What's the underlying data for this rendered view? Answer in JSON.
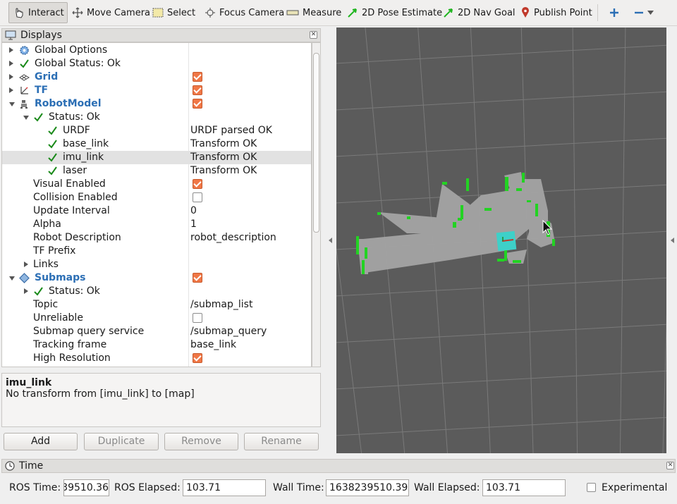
{
  "toolbar": {
    "interact": "Interact",
    "move_camera": "Move Camera",
    "select": "Select",
    "focus_camera": "Focus Camera",
    "measure": "Measure",
    "pose_estimate": "2D Pose Estimate",
    "nav_goal": "2D Nav Goal",
    "publish_point": "Publish Point"
  },
  "displays": {
    "title": "Displays",
    "rows": [
      {
        "name": "Global Options",
        "value": ""
      },
      {
        "name": "Global Status: Ok",
        "value": ""
      },
      {
        "name": "Grid",
        "value": "",
        "checked": true
      },
      {
        "name": "TF",
        "value": "",
        "checked": true
      },
      {
        "name": "RobotModel",
        "value": "",
        "checked": true
      },
      {
        "name": "Status: Ok",
        "value": ""
      },
      {
        "name": "URDF",
        "value": "URDF parsed OK"
      },
      {
        "name": "base_link",
        "value": "Transform OK"
      },
      {
        "name": "imu_link",
        "value": "Transform OK"
      },
      {
        "name": "laser",
        "value": "Transform OK"
      },
      {
        "name": "Visual Enabled",
        "value": "",
        "checked": true
      },
      {
        "name": "Collision Enabled",
        "value": "",
        "checked": false
      },
      {
        "name": "Update Interval",
        "value": "0"
      },
      {
        "name": "Alpha",
        "value": "1"
      },
      {
        "name": "Robot Description",
        "value": "robot_description"
      },
      {
        "name": "TF Prefix",
        "value": ""
      },
      {
        "name": "Links",
        "value": ""
      },
      {
        "name": "Submaps",
        "value": "",
        "checked": true
      },
      {
        "name": "Status: Ok",
        "value": ""
      },
      {
        "name": "Topic",
        "value": "/submap_list"
      },
      {
        "name": "Unreliable",
        "value": "",
        "checked": false
      },
      {
        "name": "Submap query service",
        "value": "/submap_query"
      },
      {
        "name": "Tracking frame",
        "value": "base_link"
      },
      {
        "name": "High Resolution",
        "value": "",
        "checked": true
      }
    ]
  },
  "description": {
    "title": "imu_link",
    "body": "No transform from [imu_link] to [map]"
  },
  "buttons": {
    "add": "Add",
    "duplicate": "Duplicate",
    "remove": "Remove",
    "rename": "Rename"
  },
  "time": {
    "title": "Time",
    "ros_time_label": "ROS Time:",
    "ros_time_value": "39510.36",
    "ros_elapsed_label": "ROS Elapsed:",
    "ros_elapsed_value": "103.71",
    "wall_time_label": "Wall Time:",
    "wall_time_value": "1638239510.39",
    "wall_elapsed_label": "Wall Elapsed:",
    "wall_elapsed_value": "103.71",
    "experimental_label": "Experimental",
    "experimental_checked": false
  },
  "colors": {
    "accent_blue": "#2c6fb5",
    "checkbox_orange": "#f07746",
    "view_background": "#5b5b5b",
    "map_free": "#a4a4a4",
    "map_obstacle": "#22d322",
    "robot_cyan": "#3ed0c8"
  }
}
